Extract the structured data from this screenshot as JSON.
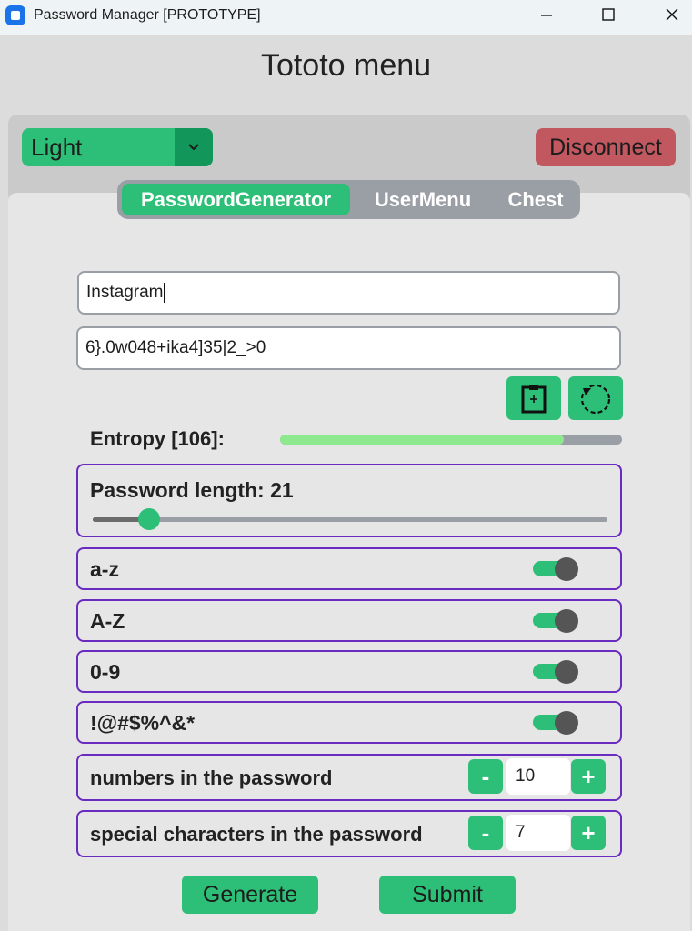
{
  "window": {
    "title": "Password Manager [PROTOTYPE]",
    "controls": {
      "minimize": "—",
      "maximize": "☐",
      "close": "✕"
    }
  },
  "page_title": "Tototo menu",
  "theme": {
    "value": "Light"
  },
  "disconnect_label": "Disconnect",
  "tabs": [
    {
      "label": "PasswordGenerator",
      "active": true
    },
    {
      "label": "UserMenu",
      "active": false
    },
    {
      "label": "Chest",
      "active": false
    }
  ],
  "site_field": {
    "value": "Instagram"
  },
  "password_field": {
    "value": "6}.0w048+ika4]35|2_>0"
  },
  "entropy": {
    "label": "Entropy [106]:",
    "fraction": 0.83
  },
  "password_length": {
    "label": "Password length: 21",
    "value": 21,
    "slider_fraction": 0.11
  },
  "options": [
    {
      "label": "a-z",
      "enabled": true
    },
    {
      "label": "A-Z",
      "enabled": true
    },
    {
      "label": "0-9",
      "enabled": true
    },
    {
      "label": "!@#$%^&*",
      "enabled": true
    }
  ],
  "counters": [
    {
      "label": "numbers in the password",
      "value": "10",
      "minus": "-",
      "plus": "+"
    },
    {
      "label": "special characters in the password",
      "value": "7",
      "minus": "-",
      "plus": "+"
    }
  ],
  "buttons": {
    "generate": "Generate",
    "submit": "Submit"
  },
  "colors": {
    "accent": "#2dbf77",
    "danger": "#c1575f",
    "group_border": "#6a2bc0",
    "entropy_fill": "#8ee88e"
  },
  "icons": {
    "copy": "clipboard-icon",
    "regenerate": "refresh-icon",
    "dropdown": "chevron-down-icon"
  }
}
